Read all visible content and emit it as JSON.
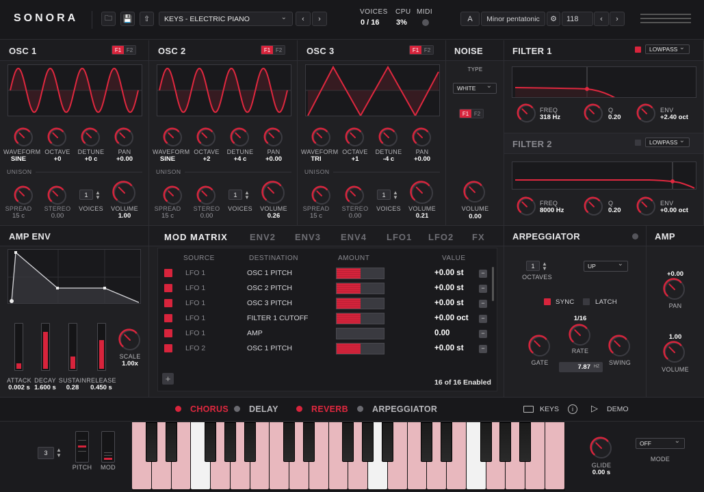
{
  "header": {
    "logo": "SONORA",
    "preset": "KEYS - ELECTRIC PIANO",
    "voices_label": "VOICES",
    "voices_value": "0 / 16",
    "cpu_label": "CPU",
    "cpu_value": "3%",
    "midi_label": "MIDI",
    "key": "A",
    "scale": "Minor pentatonic",
    "tempo": "118"
  },
  "osc": [
    {
      "title": "OSC 1",
      "waveform_label": "WAVEFORM",
      "waveform": "SINE",
      "octave_label": "OCTAVE",
      "octave": "+0",
      "detune_label": "DETUNE",
      "detune": "+0 c",
      "pan_label": "PAN",
      "pan": "+0.00",
      "unison": "UNISON",
      "spread_label": "SPREAD",
      "spread": "15 c",
      "stereo_label": "STEREO",
      "stereo": "0.00",
      "voices_label": "VOICES",
      "voices": "1",
      "volume_label": "VOLUME",
      "volume": "1.00"
    },
    {
      "title": "OSC 2",
      "waveform_label": "WAVEFORM",
      "waveform": "SINE",
      "octave_label": "OCTAVE",
      "octave": "+2",
      "detune_label": "DETUNE",
      "detune": "+4 c",
      "pan_label": "PAN",
      "pan": "+0.00",
      "unison": "UNISON",
      "spread_label": "SPREAD",
      "spread": "15 c",
      "stereo_label": "STEREO",
      "stereo": "0.00",
      "voices_label": "VOICES",
      "voices": "1",
      "volume_label": "VOLUME",
      "volume": "0.26"
    },
    {
      "title": "OSC 3",
      "waveform_label": "WAVEFORM",
      "waveform": "TRI",
      "octave_label": "OCTAVE",
      "octave": "+1",
      "detune_label": "DETUNE",
      "detune": "-4 c",
      "pan_label": "PAN",
      "pan": "+0.00",
      "unison": "UNISON",
      "spread_label": "SPREAD",
      "spread": "15 c",
      "stereo_label": "STEREO",
      "stereo": "0.00",
      "voices_label": "VOICES",
      "voices": "1",
      "volume_label": "VOLUME",
      "volume": "0.21"
    }
  ],
  "seg": {
    "f1": "F1",
    "f2": "F2"
  },
  "noise": {
    "title": "NOISE",
    "type_label": "TYPE",
    "type": "WHITE",
    "volume_label": "VOLUME",
    "volume": "0.00"
  },
  "filter1": {
    "title": "FILTER 1",
    "mode": "LOWPASS",
    "freq_label": "FREQ",
    "freq": "318 Hz",
    "q_label": "Q",
    "q": "0.20",
    "env_label": "ENV",
    "env": "+2.40 oct"
  },
  "filter2": {
    "title": "FILTER 2",
    "mode": "LOWPASS",
    "freq_label": "FREQ",
    "freq": "8000 Hz",
    "q_label": "Q",
    "q": "0.20",
    "env_label": "ENV",
    "env": "+0.00 oct"
  },
  "ampenv": {
    "title": "AMP ENV",
    "attack_label": "ATTACK",
    "attack": "0.002 s",
    "decay_label": "DECAY",
    "decay": "1.600 s",
    "sustain_label": "SUSTAIN",
    "sustain": "0.28",
    "release_label": "RELEASE",
    "release": "0.450 s",
    "scale_label": "SCALE",
    "scale": "1.00x",
    "attack_level": 0.12,
    "decay_level": 0.85,
    "sustain_level": 0.28,
    "release_level": 0.65
  },
  "tabs": [
    "MOD MATRIX",
    "ENV2",
    "ENV3",
    "ENV4",
    "LFO1",
    "LFO2",
    "FX"
  ],
  "modmatrix": {
    "col_source": "SOURCE",
    "col_dest": "DESTINATION",
    "col_amount": "AMOUNT",
    "col_value": "VALUE",
    "footer": "16 of 16 Enabled",
    "add": "+",
    "rows": [
      {
        "source": "LFO 1",
        "dest": "OSC 1 PITCH",
        "value": "+0.00 st",
        "amount": 0.5
      },
      {
        "source": "LFO 1",
        "dest": "OSC 2 PITCH",
        "value": "+0.00 st",
        "amount": 0.5
      },
      {
        "source": "LFO 1",
        "dest": "OSC 3 PITCH",
        "value": "+0.00 st",
        "amount": 0.5
      },
      {
        "source": "LFO 1",
        "dest": "FILTER 1 CUTOFF",
        "value": "+0.00 oct",
        "amount": 0.5
      },
      {
        "source": "LFO 1",
        "dest": "AMP",
        "value": "0.00",
        "amount": 0
      },
      {
        "source": "LFO 2",
        "dest": "OSC 1 PITCH",
        "value": "+0.00 st",
        "amount": 0.5
      }
    ]
  },
  "arp": {
    "title": "ARPEGGIATOR",
    "octaves": "1",
    "octaves_label": "OCTAVES",
    "direction": "UP",
    "sync_label": "SYNC",
    "latch_label": "LATCH",
    "rate_value": "1/16",
    "rate_label": "RATE",
    "gate_label": "GATE",
    "swing_label": "SWING",
    "hz": "7.87",
    "hz_unit": "HZ"
  },
  "amp": {
    "title": "AMP",
    "pan_value": "+0.00",
    "pan_label": "PAN",
    "volume_value": "1.00",
    "volume_label": "VOLUME"
  },
  "fxbar": {
    "chorus": "CHORUS",
    "delay": "DELAY",
    "reverb": "REVERB",
    "arpeggiator": "ARPEGGIATOR",
    "keys": "KEYS",
    "demo": "DEMO"
  },
  "keyboard": {
    "octave": "3",
    "pitch_label": "PITCH",
    "mod_label": "MOD",
    "glide_label": "GLIDE",
    "glide": "0.00 s",
    "mode_label": "MODE",
    "mode": "OFF"
  },
  "colors": {
    "accent": "#d8243c",
    "bg": "#1d1d20"
  }
}
